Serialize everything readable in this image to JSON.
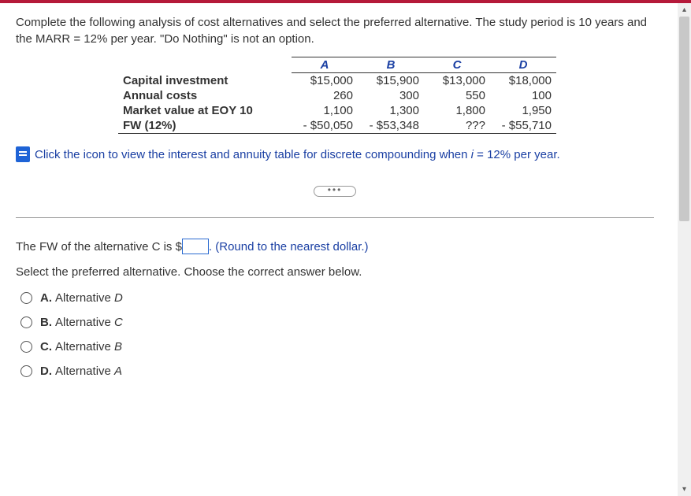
{
  "question": {
    "text": "Complete the following analysis of cost alternatives and select the preferred alternative. The study period is 10 years and the MARR = 12% per year. \"Do Nothing\" is not an option."
  },
  "table": {
    "headers": [
      "A",
      "B",
      "C",
      "D"
    ],
    "rows": [
      {
        "label": "Capital investment",
        "values": [
          "$15,000",
          "$15,900",
          "$13,000",
          "$18,000"
        ]
      },
      {
        "label": "Annual costs",
        "values": [
          "260",
          "300",
          "550",
          "100"
        ]
      },
      {
        "label": "Market value at EOY 10",
        "values": [
          "1,100",
          "1,300",
          "1,800",
          "1,950"
        ]
      },
      {
        "label": "FW (12%)",
        "values": [
          "- $50,050",
          "- $53,348",
          "???",
          "- $55,710"
        ]
      }
    ]
  },
  "link": {
    "prefix": "Click the icon to view the interest and annuity table for discrete compounding when ",
    "var": "i",
    "suffix": " = 12% per year."
  },
  "answer": {
    "prefix": "The FW of the alternative C is $",
    "hint": ". (Round to the nearest dollar.)",
    "instruction": "Select the preferred alternative. Choose the correct answer below."
  },
  "choices": [
    {
      "letter": "A.",
      "word": "Alternative ",
      "alt": "D"
    },
    {
      "letter": "B.",
      "word": "Alternative ",
      "alt": "C"
    },
    {
      "letter": "C.",
      "word": "Alternative ",
      "alt": "B"
    },
    {
      "letter": "D.",
      "word": "Alternative ",
      "alt": "A"
    }
  ],
  "ellipsis": "•••"
}
